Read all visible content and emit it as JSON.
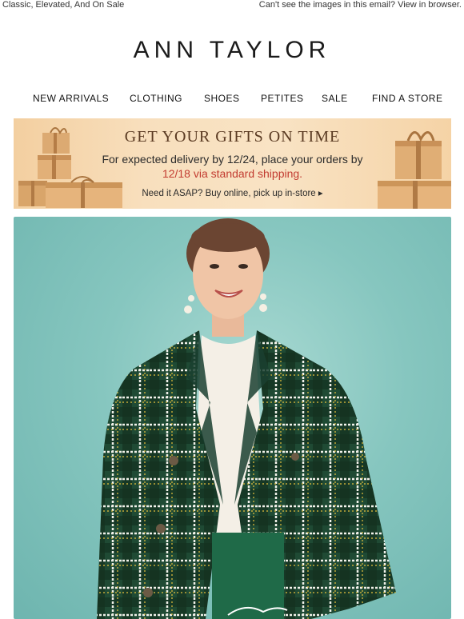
{
  "preheader": {
    "tagline": "Classic, Elevated, And On Sale",
    "view_in_browser": "Can't see the images in this email? View in browser."
  },
  "brand": {
    "logo_text": "ANN TAYLOR"
  },
  "nav": {
    "items": [
      {
        "label": "NEW ARRIVALS"
      },
      {
        "label": "CLOTHING"
      },
      {
        "label": "SHOES"
      },
      {
        "label": "PETITES"
      },
      {
        "label": "SALE"
      },
      {
        "label": "FIND A STORE"
      }
    ]
  },
  "banner": {
    "heading": "GET YOUR GIFTS ON TIME",
    "line1": "For expected delivery by 12/24, place your orders by",
    "line2": "12/18 via standard shipping.",
    "cta": "Need it ASAP? Buy online, pick up in-store ▸"
  },
  "colors": {
    "banner_heading": "#5a3a22",
    "banner_highlight": "#c23b30",
    "hero_background": "#86c6bf",
    "coat_green": "#1f4a34"
  }
}
